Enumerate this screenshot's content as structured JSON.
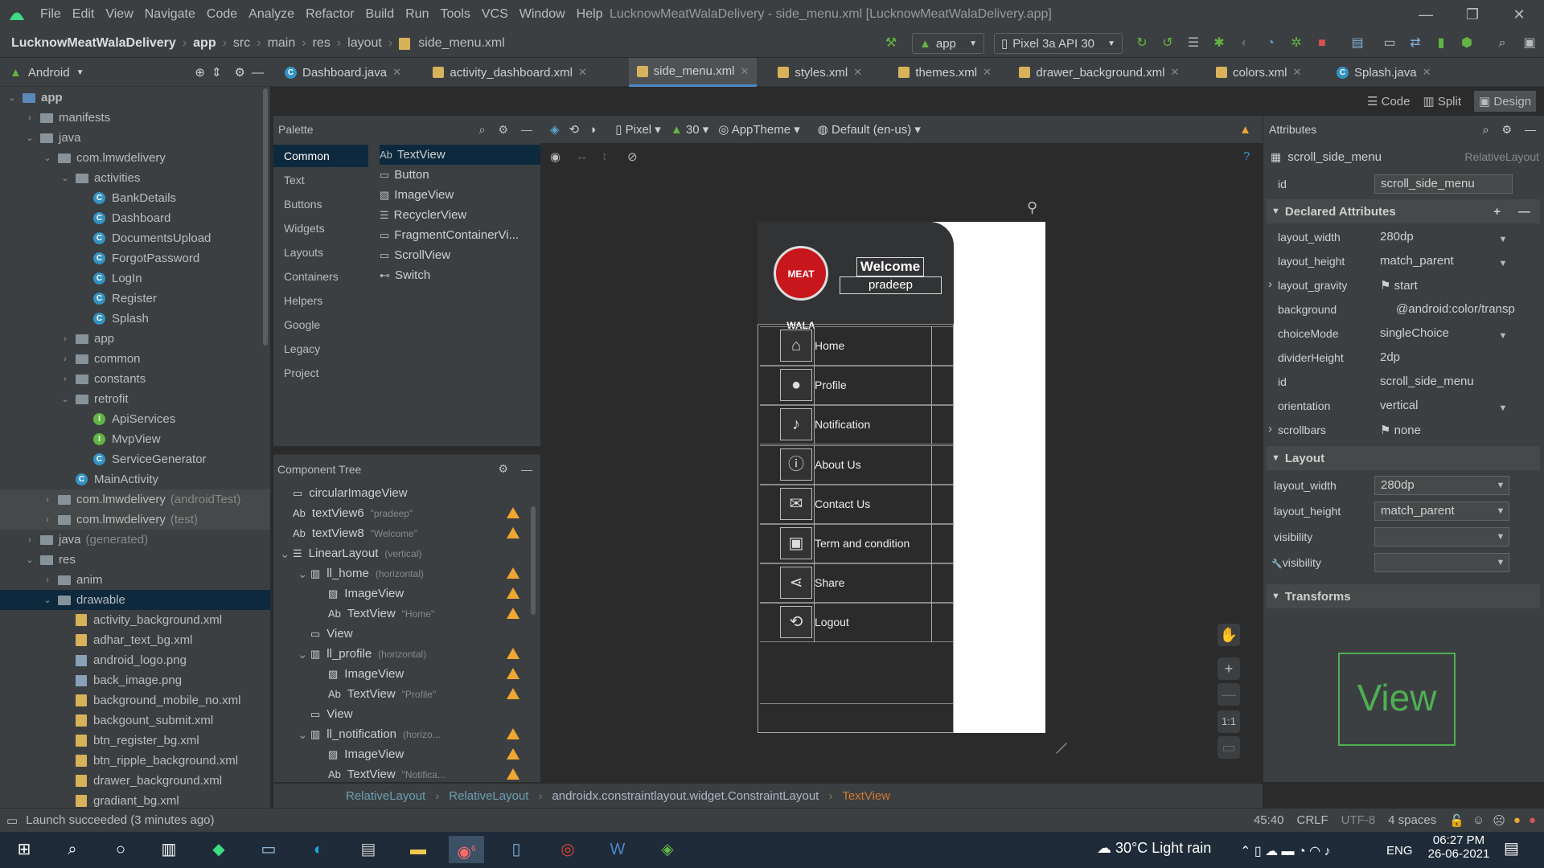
{
  "menubar": {
    "items": [
      "File",
      "Edit",
      "View",
      "Navigate",
      "Code",
      "Analyze",
      "Refactor",
      "Build",
      "Run",
      "Tools",
      "VCS",
      "Window",
      "Help"
    ],
    "window_title": "LucknowMeatWalaDelivery - side_menu.xml [LucknowMeatWalaDelivery.app]"
  },
  "navbar": {
    "crumbs": [
      "LucknowMeatWalaDelivery",
      "app",
      "src",
      "main",
      "res",
      "layout",
      "side_menu.xml"
    ],
    "run_config": "app",
    "device": "Pixel 3a API 30"
  },
  "project": {
    "view": "Android"
  },
  "tabs": [
    {
      "label": "Dashboard.java",
      "kind": "java"
    },
    {
      "label": "activity_dashboard.xml",
      "kind": "xml"
    },
    {
      "label": "side_menu.xml",
      "kind": "xml",
      "active": true
    },
    {
      "label": "styles.xml",
      "kind": "xml"
    },
    {
      "label": "themes.xml",
      "kind": "xml"
    },
    {
      "label": "drawer_background.xml",
      "kind": "xml"
    },
    {
      "label": "colors.xml",
      "kind": "xml"
    },
    {
      "label": "Splash.java",
      "kind": "java"
    }
  ],
  "tree": [
    {
      "label": "app",
      "depth": 0,
      "arrow": "down",
      "icon": "folder-blue",
      "bold": true
    },
    {
      "label": "manifests",
      "depth": 1,
      "arrow": "right",
      "icon": "folder"
    },
    {
      "label": "java",
      "depth": 1,
      "arrow": "down",
      "icon": "folder"
    },
    {
      "label": "com.lmwdelivery",
      "depth": 2,
      "arrow": "down",
      "icon": "folder"
    },
    {
      "label": "activities",
      "depth": 3,
      "arrow": "down",
      "icon": "folder"
    },
    {
      "label": "BankDetails",
      "depth": 4,
      "icon": "class"
    },
    {
      "label": "Dashboard",
      "depth": 4,
      "icon": "class"
    },
    {
      "label": "DocumentsUpload",
      "depth": 4,
      "icon": "class"
    },
    {
      "label": "ForgotPassword",
      "depth": 4,
      "icon": "class"
    },
    {
      "label": "LogIn",
      "depth": 4,
      "icon": "class"
    },
    {
      "label": "Register",
      "depth": 4,
      "icon": "class"
    },
    {
      "label": "Splash",
      "depth": 4,
      "icon": "class"
    },
    {
      "label": "app",
      "depth": 3,
      "arrow": "right",
      "icon": "folder"
    },
    {
      "label": "common",
      "depth": 3,
      "arrow": "right",
      "icon": "folder"
    },
    {
      "label": "constants",
      "depth": 3,
      "arrow": "right",
      "icon": "folder"
    },
    {
      "label": "retrofit",
      "depth": 3,
      "arrow": "down",
      "icon": "folder"
    },
    {
      "label": "ApiServices",
      "depth": 4,
      "icon": "interface"
    },
    {
      "label": "MvpView",
      "depth": 4,
      "icon": "interface"
    },
    {
      "label": "ServiceGenerator",
      "depth": 4,
      "icon": "class"
    },
    {
      "label": "MainActivity",
      "depth": 3,
      "icon": "class"
    },
    {
      "label": "com.lmwdelivery",
      "suffix": "(androidTest)",
      "depth": 2,
      "arrow": "right",
      "icon": "folder",
      "hl": true
    },
    {
      "label": "com.lmwdelivery",
      "suffix": "(test)",
      "depth": 2,
      "arrow": "right",
      "icon": "folder",
      "hl": true
    },
    {
      "label": "java",
      "suffix": "(generated)",
      "depth": 1,
      "arrow": "right",
      "icon": "folder"
    },
    {
      "label": "res",
      "depth": 1,
      "arrow": "down",
      "icon": "folder"
    },
    {
      "label": "anim",
      "depth": 2,
      "arrow": "right",
      "icon": "folder"
    },
    {
      "label": "drawable",
      "depth": 2,
      "arrow": "down",
      "icon": "folder",
      "sel": true
    },
    {
      "label": "activity_background.xml",
      "depth": 3,
      "icon": "xml"
    },
    {
      "label": "adhar_text_bg.xml",
      "depth": 3,
      "icon": "xml"
    },
    {
      "label": "android_logo.png",
      "depth": 3,
      "icon": "png"
    },
    {
      "label": "back_image.png",
      "depth": 3,
      "icon": "png"
    },
    {
      "label": "background_mobile_no.xml",
      "depth": 3,
      "icon": "xml"
    },
    {
      "label": "backgount_submit.xml",
      "depth": 3,
      "icon": "xml"
    },
    {
      "label": "btn_register_bg.xml",
      "depth": 3,
      "icon": "xml"
    },
    {
      "label": "btn_ripple_background.xml",
      "depth": 3,
      "icon": "xml"
    },
    {
      "label": "drawer_background.xml",
      "depth": 3,
      "icon": "xml"
    },
    {
      "label": "gradiant_bg.xml",
      "depth": 3,
      "icon": "xml"
    }
  ],
  "palette": {
    "title": "Palette",
    "categories": [
      "Common",
      "Text",
      "Buttons",
      "Widgets",
      "Layouts",
      "Containers",
      "Helpers",
      "Google",
      "Legacy",
      "Project"
    ],
    "items": [
      {
        "icon": "Ab",
        "label": "TextView"
      },
      {
        "icon": "▭",
        "label": "Button"
      },
      {
        "icon": "▨",
        "label": "ImageView"
      },
      {
        "icon": "☰",
        "label": "RecyclerView"
      },
      {
        "icon": "▭",
        "label": "FragmentContainerVi..."
      },
      {
        "icon": "▭",
        "label": "ScrollView"
      },
      {
        "icon": "⊷",
        "label": "Switch"
      }
    ]
  },
  "component_tree": {
    "title": "Component Tree",
    "rows": [
      {
        "icon": "▭",
        "label": "circularImageView",
        "depth": 0
      },
      {
        "icon": "Ab",
        "label": "textView6",
        "sub": "\"pradeep\"",
        "depth": 0,
        "warn": true
      },
      {
        "icon": "Ab",
        "label": "textView8",
        "sub": "\"Welcome\"",
        "depth": 0,
        "warn": true
      },
      {
        "icon": "☰",
        "label": "LinearLayout",
        "sub": "(vertical)",
        "depth": 0,
        "arrow": "down"
      },
      {
        "icon": "▥",
        "label": "ll_home",
        "sub": "(horizontal)",
        "depth": 1,
        "arrow": "down",
        "warn": true
      },
      {
        "icon": "▨",
        "label": "ImageView",
        "depth": 2,
        "warn": true
      },
      {
        "icon": "Ab",
        "label": "TextView",
        "sub": "\"Home\"",
        "depth": 2,
        "warn": true
      },
      {
        "icon": "▭",
        "label": "View",
        "depth": 1
      },
      {
        "icon": "▥",
        "label": "ll_profile",
        "sub": "(horizontal)",
        "depth": 1,
        "arrow": "down",
        "warn": true
      },
      {
        "icon": "▨",
        "label": "ImageView",
        "depth": 2,
        "warn": true
      },
      {
        "icon": "Ab",
        "label": "TextView",
        "sub": "\"Profile\"",
        "depth": 2,
        "warn": true
      },
      {
        "icon": "▭",
        "label": "View",
        "depth": 1
      },
      {
        "icon": "▥",
        "label": "ll_notification",
        "sub": "(horizo...",
        "depth": 1,
        "arrow": "down",
        "warn": true
      },
      {
        "icon": "▨",
        "label": "ImageView",
        "depth": 2,
        "warn": true
      },
      {
        "icon": "Ab",
        "label": "TextView",
        "sub": "\"Notifica...",
        "depth": 2,
        "warn": true
      }
    ]
  },
  "design_toolbar": {
    "device": "Pixel",
    "api": "30",
    "theme": "AppTheme",
    "locale": "Default (en-us)"
  },
  "view_modes": [
    "Code",
    "Split",
    "Design"
  ],
  "drawer": {
    "logo_text": "MEAT WALA",
    "welcome": "Welcome",
    "user": "pradeep",
    "menu": [
      {
        "label": "Home",
        "icon": "⌂"
      },
      {
        "label": "Profile",
        "icon": "●"
      },
      {
        "label": "Notification",
        "icon": "♪"
      },
      {
        "label": "About Us",
        "icon": "ⓘ"
      },
      {
        "label": "Contact Us",
        "icon": "✉"
      },
      {
        "label": "Term and condition",
        "icon": "▣"
      },
      {
        "label": "Share",
        "icon": "⋖"
      },
      {
        "label": "Logout",
        "icon": "⟲"
      }
    ]
  },
  "attributes": {
    "title": "Attributes",
    "component": "scroll_side_menu",
    "component_type": "RelativeLayout",
    "id_label": "id",
    "id_value": "scroll_side_menu",
    "declared_header": "Declared Attributes",
    "declared": [
      {
        "name": "layout_width",
        "value": "280dp",
        "dd": true
      },
      {
        "name": "layout_height",
        "value": "match_parent",
        "dd": true
      },
      {
        "name": "layout_gravity",
        "value": "start",
        "flag": true,
        "expand": true
      },
      {
        "name": "background",
        "value": "@android:color/transp"
      },
      {
        "name": "choiceMode",
        "value": "singleChoice",
        "dd": true
      },
      {
        "name": "dividerHeight",
        "value": "2dp"
      },
      {
        "name": "id",
        "value": "scroll_side_menu"
      },
      {
        "name": "orientation",
        "value": "vertical",
        "dd": true
      },
      {
        "name": "scrollbars",
        "value": "none",
        "flag": true,
        "expand": true
      }
    ],
    "layout_header": "Layout",
    "layout": [
      {
        "name": "layout_width",
        "value": "280dp"
      },
      {
        "name": "layout_height",
        "value": "match_parent"
      },
      {
        "name": "visibility",
        "value": ""
      },
      {
        "name": "visibility",
        "value": "",
        "tool": true
      }
    ],
    "transforms_header": "Transforms",
    "preview_text": "View"
  },
  "bottom_crumbs": [
    "RelativeLayout",
    "RelativeLayout",
    "androidx.constraintlayout.widget.ConstraintLayout",
    "TextView"
  ],
  "status": {
    "message": "Launch succeeded (3 minutes ago)",
    "position": "45:40",
    "line_sep": "CRLF",
    "encoding": "UTF-8",
    "indent": "4 spaces"
  },
  "taskbar": {
    "weather": "30°C  Light rain",
    "lang": "ENG",
    "time": "06:27 PM",
    "date": "26-06-2021",
    "notif_count": "6"
  },
  "colors": {
    "accent": "#4a88c7",
    "warning": "#f0a732",
    "selection": "#0d293e",
    "brand_red": "#c8161d",
    "preview_green": "#4fae52"
  }
}
